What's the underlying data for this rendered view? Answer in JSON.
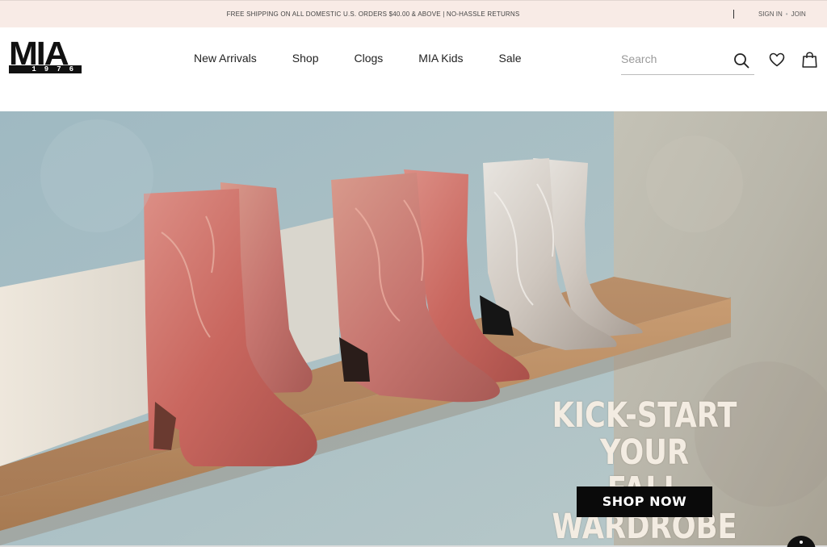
{
  "promo": {
    "text": "FREE SHIPPING ON ALL DOMESTIC U.S. ORDERS $40.00 & ABOVE | NO-HASSLE RETURNS",
    "sign_in": "SIGN IN",
    "separator": "•",
    "join": "JOIN"
  },
  "logo": {
    "word": "MIA",
    "year": "1976"
  },
  "nav": {
    "items": [
      {
        "label": "New Arrivals"
      },
      {
        "label": "Shop"
      },
      {
        "label": "Clogs"
      },
      {
        "label": "MIA Kids"
      },
      {
        "label": "Sale"
      }
    ]
  },
  "search": {
    "placeholder": "Search",
    "value": ""
  },
  "icons": {
    "search": "search-icon",
    "wishlist": "heart-icon",
    "cart": "shopping-bag-icon",
    "accessibility": "accessibility-icon"
  },
  "hero": {
    "headline_line1": "KICK-START YOUR",
    "headline_line2": "FALL WARDROBE",
    "cta_label": "SHOP NOW"
  },
  "colors": {
    "promo_bg": "#f8ebe6",
    "cta_bg": "#0a0a0a",
    "headline_text": "#f3ece2",
    "wall": "#a9c0c7",
    "shelf": "#b68d66",
    "boot_rose": "#c8757a",
    "boot_silver": "#cfc8c2"
  }
}
